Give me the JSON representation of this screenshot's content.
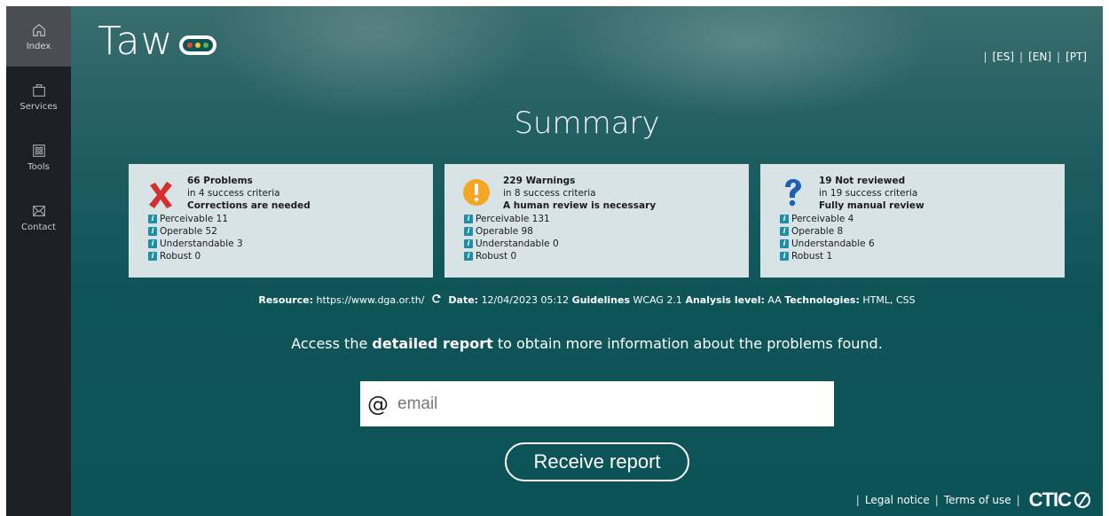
{
  "sidebar": {
    "items": [
      {
        "label": "Index",
        "icon": "home-icon"
      },
      {
        "label": "Services",
        "icon": "briefcase-icon"
      },
      {
        "label": "Tools",
        "icon": "grid-icon"
      },
      {
        "label": "Contact",
        "icon": "mail-icon"
      }
    ]
  },
  "header": {
    "logo_text": "Taw",
    "lang": [
      "[ES]",
      "[EN]",
      "[PT]"
    ],
    "lang_sep": "|"
  },
  "title": "Summary",
  "cards": [
    {
      "icon": "error-x-icon",
      "count_label": "66 Problems",
      "criteria": "in 4 success criteria",
      "note": "Corrections are needed",
      "items": [
        "Perceivable 11",
        "Operable 52",
        "Understandable 3",
        "Robust 0"
      ]
    },
    {
      "icon": "warning-icon",
      "count_label": "229 Warnings",
      "criteria": "in 8 success criteria",
      "note": "A human review is necessary",
      "items": [
        "Perceivable 131",
        "Operable 98",
        "Understandable 0",
        "Robust 0"
      ]
    },
    {
      "icon": "question-icon",
      "count_label": "19 Not reviewed",
      "criteria": "in 19 success criteria",
      "note": "Fully manual review",
      "items": [
        "Perceivable 4",
        "Operable 8",
        "Understandable 6",
        "Robust 1"
      ]
    }
  ],
  "meta": {
    "resource_label": "Resource:",
    "resource_value": "https://www.dga.or.th/",
    "date_label": "Date:",
    "date_value": "12/04/2023 05:12",
    "guidelines_label": "Guidelines",
    "guidelines_value": "WCAG 2.1",
    "level_label": "Analysis level:",
    "level_value": "AA",
    "tech_label": "Technologies:",
    "tech_value": "HTML, CSS"
  },
  "access": {
    "before": "Access the",
    "bold": "detailed report",
    "after": "to obtain more information about the problems found."
  },
  "email": {
    "at": "@",
    "placeholder": "email",
    "value": ""
  },
  "button_label": "Receive report",
  "footer": {
    "legal": "Legal notice",
    "terms": "Terms of use",
    "brand": "CTIC",
    "sep": "|"
  },
  "info_glyph": "i",
  "colors": {
    "accent": "#0b5357",
    "info": "#1e8ea9",
    "error": "#d32f2f",
    "warning": "#f6a623",
    "question": "#1f5fb3"
  }
}
